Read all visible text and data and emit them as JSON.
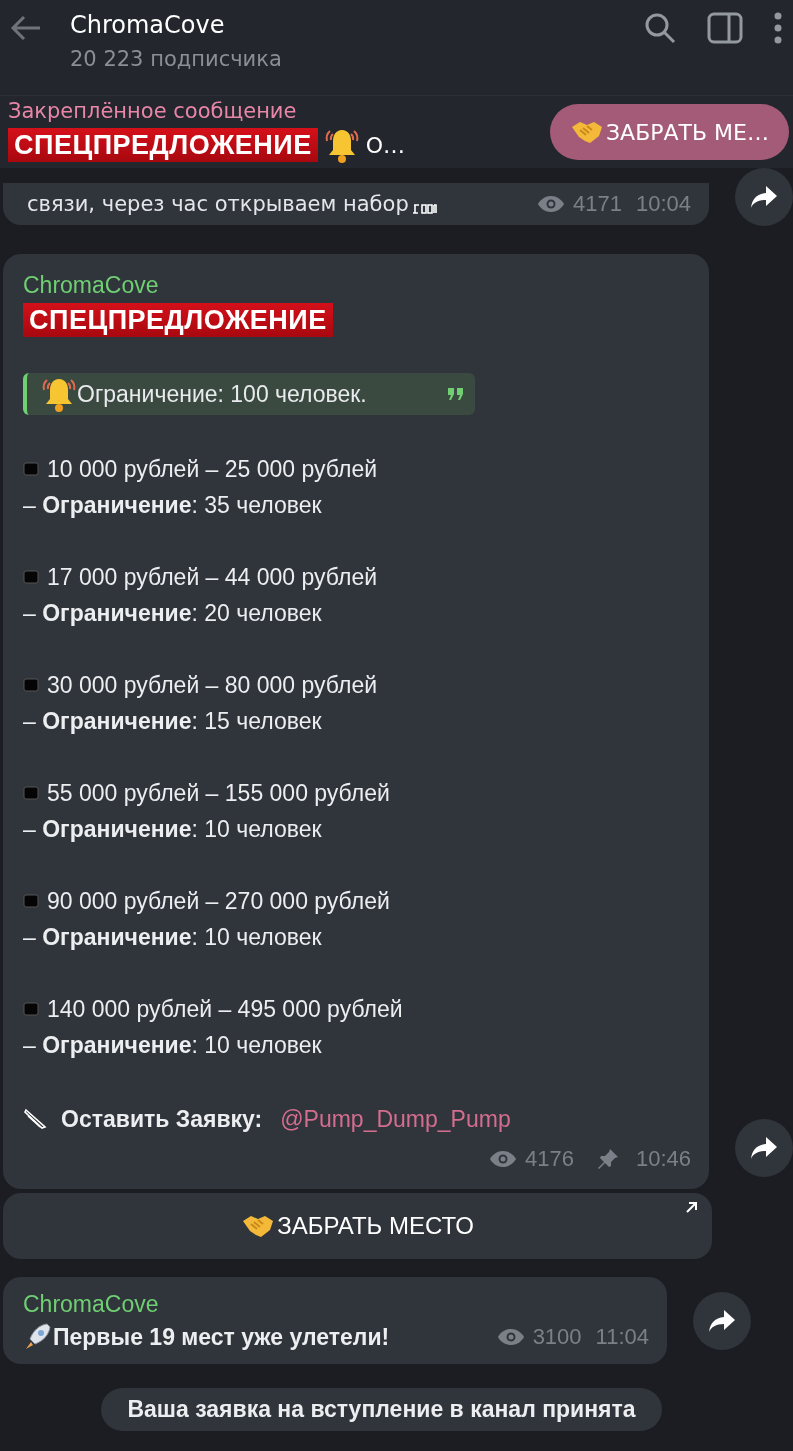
{
  "header": {
    "title": "ChromaCove",
    "subtitle": "20 223 подписчика"
  },
  "pinned": {
    "label": "Закреплённое сообщение",
    "banner": "СПЕЦПРЕДЛОЖЕНИЕ",
    "snippet": "О…",
    "button": "ЗАБРАТЬ МЕ…"
  },
  "messages": [
    {
      "kind": "partial",
      "text": "связи, через час открываем набор",
      "views": "4171",
      "time": "10:04",
      "pinned": false
    },
    {
      "kind": "post",
      "author": "ChromaCove",
      "banner": "СПЕЦПРЕДЛОЖЕНИЕ",
      "quote": "Ограничение: 100 человек.",
      "tiers": [
        {
          "range": "10 000 рублей – 25 000 рублей",
          "limit": "– **Ограничение**: 35 человек"
        },
        {
          "range": "17 000 рублей – 44 000 рублей",
          "limit": "– **Ограничение**: 20 человек"
        },
        {
          "range": "30 000 рублей – 80 000 рублей",
          "limit": "– **Ограничение**: 15 человек"
        },
        {
          "range": "55 000 рублей – 155 000 рублей",
          "limit": "– **Ограничение**: 10 человек"
        },
        {
          "range": "90 000 рублей – 270 000 рублей",
          "limit": "– **Ограничение**: 10 человек"
        },
        {
          "range": "140 000 рублей – 495 000 рублей",
          "limit": "– **Ограничение**: 10 человек"
        }
      ],
      "cta_label": "Оставить Заявку:",
      "cta_link": "@Pump_Dump_Pump",
      "views": "4176",
      "time": "10:46",
      "pinned": true,
      "button": "ЗАБРАТЬ МЕСТО"
    },
    {
      "kind": "short",
      "author": "ChromaCove",
      "text": "Первые 19 мест уже улетели!",
      "views": "3100",
      "time": "11:04",
      "pinned": false
    }
  ],
  "service": "Ваша заявка на вступление в канал принята"
}
